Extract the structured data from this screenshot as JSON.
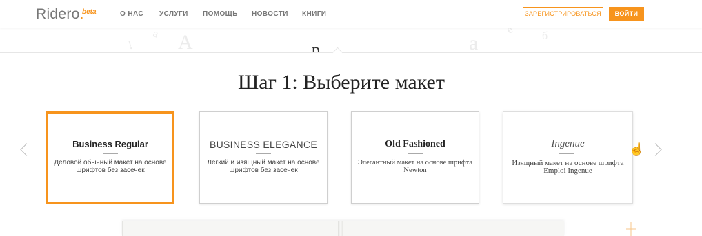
{
  "header": {
    "logo": "Ridero",
    "logo_badge": "beta",
    "nav": [
      "О НАС",
      "УСЛУГИ",
      "ПОМОЩЬ",
      "НОВОСТИ",
      "КНИГИ"
    ],
    "register_label": "ЗАРЕГИСТРИРОВАТЬСЯ",
    "login_label": "ВОЙТИ"
  },
  "hero": {
    "partial_text": "р"
  },
  "step": {
    "title": "Шаг 1: Выберите макет"
  },
  "layouts": [
    {
      "name": "Business Regular",
      "description": "Деловой обычный макет на основе шрифтов без засечек",
      "selected": true
    },
    {
      "name": "BUSINESS ELEGANCE",
      "description": "Легкий и изящный макет на основе шрифтов без засечек",
      "selected": false
    },
    {
      "name": "Old Fashioned",
      "description": "Элегантный макет на основе шрифта Newton",
      "selected": false
    },
    {
      "name": "Ingenue",
      "description": "Изящный макет на основе шрифта Emploi Ingenue",
      "selected": false
    }
  ],
  "colors": {
    "accent": "#f7941d",
    "card_border": "#cfcfcf"
  },
  "icons": {
    "prev": "chevron-left-icon",
    "next": "chevron-right-icon",
    "cursor": "hand-pointer-icon"
  }
}
